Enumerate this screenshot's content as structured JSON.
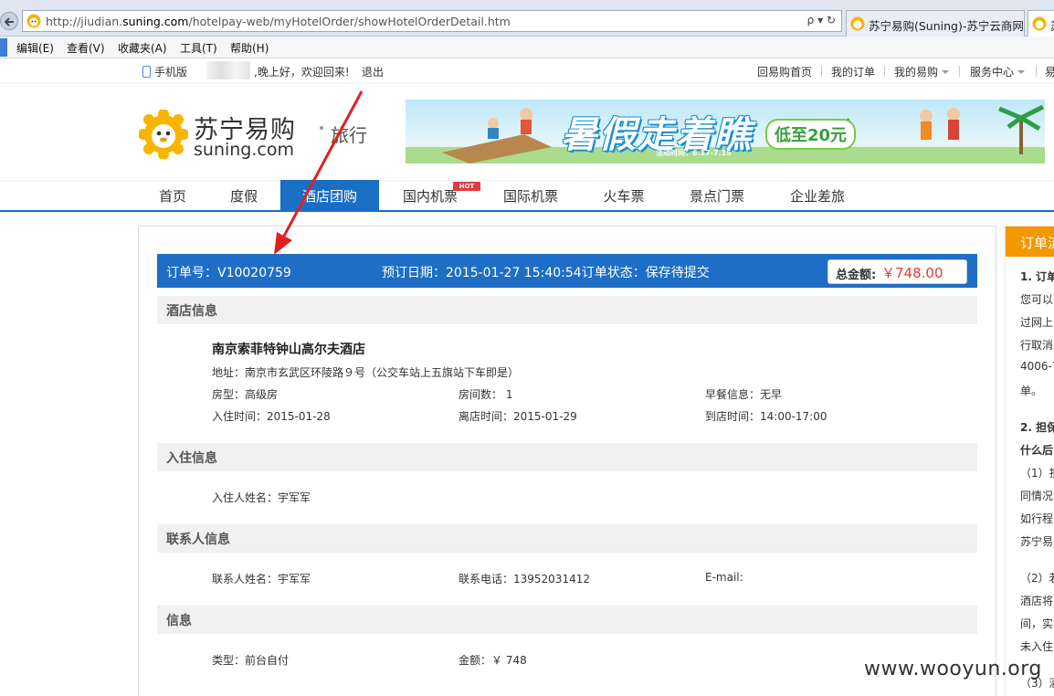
{
  "browser": {
    "url_prefix": "http://jiudian.",
    "url_domain": "suning.com",
    "url_path": "/hotelpay-web/myHotelOrder/showHotelOrderDetail.htm",
    "url_tools": "ρ ▾ ↻",
    "tabs": [
      {
        "title": "苏宁易购(Suning)-苏宁云商网..."
      },
      {
        "title": "苏"
      }
    ],
    "menu": [
      "编辑(E)",
      "查看(V)",
      "收藏夹(A)",
      "工具(T)",
      "帮助(H)"
    ]
  },
  "top_strip": {
    "phone": "手机版",
    "greeting": ",晚上好，欢迎回来!",
    "logout": "退出",
    "links": [
      "回易购首页",
      "我的订单",
      "我的易购",
      "服务中心",
      "易"
    ]
  },
  "logo": {
    "cn": "苏宁易购",
    "en": "suning.com",
    "sub": "旅行"
  },
  "banner": {
    "title": "暑假走着瞧",
    "promo": "低至20元",
    "date": "活动时间：6.17-7.15"
  },
  "nav": {
    "items": [
      "首页",
      "度假",
      "酒店团购",
      "国内机票",
      "国际机票",
      "火车票",
      "景点门票",
      "企业差旅"
    ],
    "hot": "HOT"
  },
  "order": {
    "number_label": "订单号：",
    "number": "V10020759",
    "date_label": "预订日期：",
    "date": "2015-01-27 15:40:54",
    "status_label": "订单状态：",
    "status": "保存待提交",
    "total_label": "总金额:",
    "total": "￥748.00"
  },
  "hotel": {
    "section": "酒店信息",
    "name": "南京索菲特钟山高尔夫酒店",
    "address": "地址：南京市玄武区环陵路９号（公交车站上五旗站下车即是）",
    "room_type": "房型：高级房",
    "rooms": "房间数：  1",
    "breakfast": "早餐信息：无早",
    "checkin": "入住时间：2015-01-28",
    "checkout": "离店时间：2015-01-29",
    "arrival": "到店时间：14:00-17:00"
  },
  "guest": {
    "section": "入住信息",
    "name": "入住人姓名：宇军军"
  },
  "contact": {
    "section": "联系人信息",
    "name": "联系人姓名：宇军军",
    "phone": "联系电话：13952031412",
    "email": "E-mail:"
  },
  "payment": {
    "section": "信息",
    "type": "类型：前台自付",
    "amount": "金额：￥ 748"
  },
  "side": {
    "head": "订单流",
    "lines": [
      "1. 订单",
      "您可以",
      "过网上",
      "行取消",
      "4006-7",
      "单。",
      "2. 担保",
      "什么后",
      "（1）担",
      "同情况",
      "如行程",
      "苏宁易",
      "（2）若",
      "酒店将",
      "间，实",
      "未入住",
      "（3）酒"
    ]
  },
  "watermark": "www.wooyun.org",
  "colors": {
    "nav_active": "#1a6fc4",
    "order_bar": "#1e6ec6",
    "total_red": "#e4393c",
    "side_orange": "#f39800",
    "annotation_red": "#e02020"
  }
}
